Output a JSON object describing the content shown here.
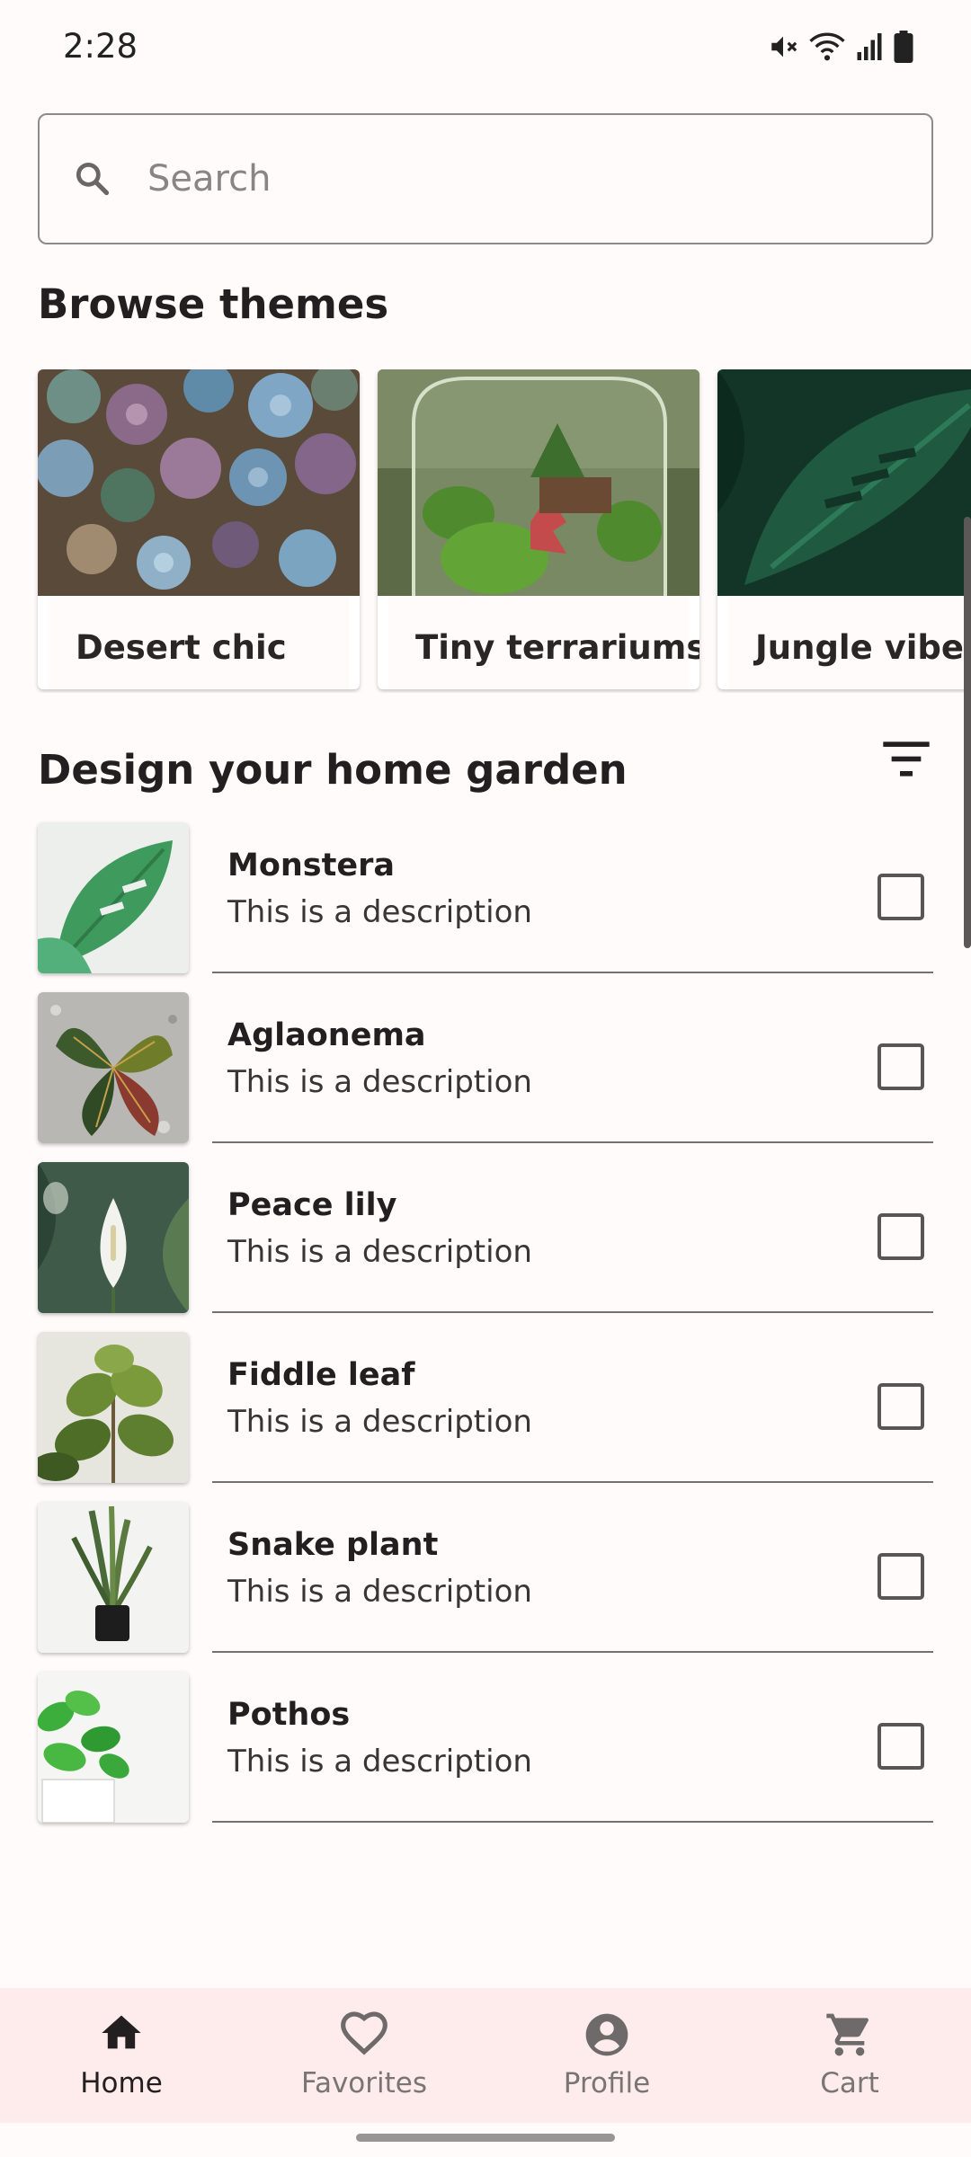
{
  "status_bar": {
    "time": "2:28",
    "icons": [
      "mute-icon",
      "wifi-icon",
      "signal-icon",
      "battery-icon"
    ]
  },
  "search": {
    "placeholder": "Search",
    "icon": "search-icon"
  },
  "themes": {
    "title": "Browse themes",
    "items": [
      {
        "label": "Desert chic"
      },
      {
        "label": "Tiny terrariums"
      },
      {
        "label": "Jungle vibes"
      }
    ]
  },
  "garden": {
    "title": "Design your home garden",
    "filter_icon": "filter-icon",
    "plants": [
      {
        "name": "Monstera",
        "description": "This is a description",
        "checked": false
      },
      {
        "name": "Aglaonema",
        "description": "This is a description",
        "checked": false
      },
      {
        "name": "Peace lily",
        "description": "This is a description",
        "checked": false
      },
      {
        "name": "Fiddle leaf",
        "description": "This is a description",
        "checked": false
      },
      {
        "name": "Snake plant",
        "description": "This is a description",
        "checked": false
      },
      {
        "name": "Pothos",
        "description": "This is a description",
        "checked": false
      }
    ]
  },
  "bottom_nav": {
    "active": "Home",
    "items": [
      {
        "label": "Home",
        "icon": "home-icon"
      },
      {
        "label": "Favorites",
        "icon": "heart-icon"
      },
      {
        "label": "Profile",
        "icon": "account-circle-icon"
      },
      {
        "label": "Cart",
        "icon": "cart-icon"
      }
    ]
  },
  "colors": {
    "background": "#fffbfb",
    "text": "#231f20",
    "nav_background": "#fdeceb",
    "divider": "#767171"
  }
}
